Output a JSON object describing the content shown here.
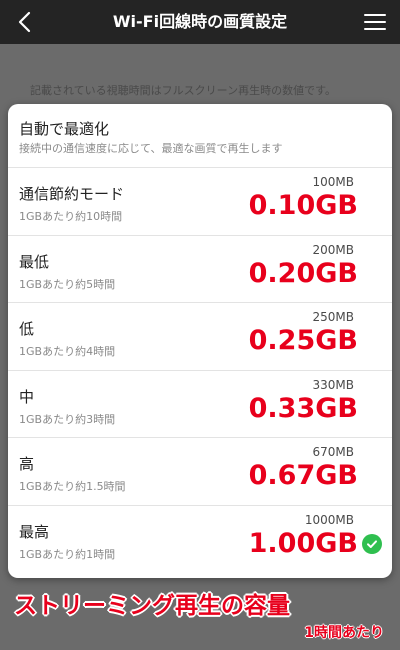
{
  "header": {
    "title": "Wi-Fi回線時の画質設定",
    "back_icon": "chevron-left-icon",
    "menu_icon": "hamburger-menu-icon"
  },
  "note": "記載されている視聴時間はフルスクリーン再生時の数値です。",
  "auto_option": {
    "title": "自動で最適化",
    "description": "接続中の通信速度に応じて、最適な画質で再生します"
  },
  "options": [
    {
      "title": "通信節約モード",
      "sub": "1GBあたり約10時間",
      "mb": "100MB",
      "gb": "0.10GB",
      "selected": false
    },
    {
      "title": "最低",
      "sub": "1GBあたり約5時間",
      "mb": "200MB",
      "gb": "0.20GB",
      "selected": false
    },
    {
      "title": "低",
      "sub": "1GBあたり約4時間",
      "mb": "250MB",
      "gb": "0.25GB",
      "selected": false
    },
    {
      "title": "中",
      "sub": "1GBあたり約3時間",
      "mb": "330MB",
      "gb": "0.33GB",
      "selected": false
    },
    {
      "title": "高",
      "sub": "1GBあたり約1.5時間",
      "mb": "670MB",
      "gb": "0.67GB",
      "selected": false
    },
    {
      "title": "最高",
      "sub": "1GBあたり約1時間",
      "mb": "1000MB",
      "gb": "1.00GB",
      "selected": true
    }
  ],
  "caption": "ストリーミング再生の容量",
  "sub_caption": "1時間あたり",
  "colors": {
    "accent_red": "#e8001c",
    "check_green": "#2fbf4f",
    "navbar": "#242424"
  }
}
